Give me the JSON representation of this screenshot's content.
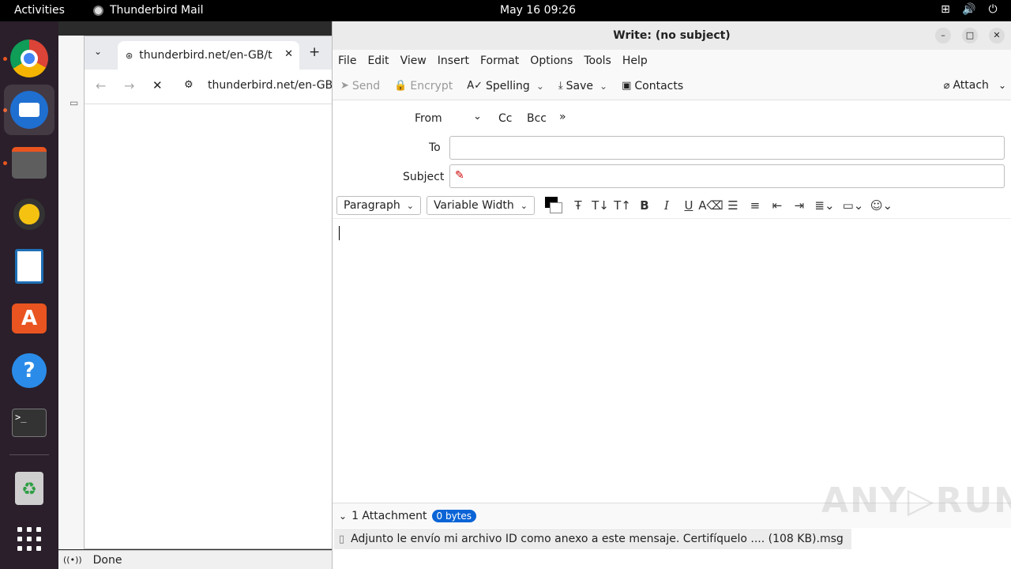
{
  "topbar": {
    "activities": "Activities",
    "app_name": "Thunderbird Mail",
    "clock": "May 16  09:26",
    "tray_icons": [
      "network-icon",
      "volume-icon",
      "power-icon"
    ]
  },
  "dock": {
    "items": [
      "chrome",
      "thunderbird",
      "files",
      "rhythmbox",
      "writer",
      "app-center",
      "help",
      "terminal",
      "trash",
      "app-grid"
    ]
  },
  "browser": {
    "tab_title": "thunderbird.net/en-GB/t",
    "new_tab": "+",
    "url": "thunderbird.net/en-GB/t",
    "status": "Done"
  },
  "compose": {
    "title": "Write: (no subject)",
    "menu": [
      "File",
      "Edit",
      "View",
      "Insert",
      "Format",
      "Options",
      "Tools",
      "Help"
    ],
    "toolbar": {
      "send": "Send",
      "encrypt": "Encrypt",
      "spelling": "Spelling",
      "save": "Save",
      "contacts": "Contacts",
      "attach": "Attach"
    },
    "header": {
      "from_label": "From",
      "cc": "Cc",
      "bcc": "Bcc",
      "to_label": "To",
      "to_value": "",
      "subject_label": "Subject",
      "subject_value": ""
    },
    "format": {
      "paragraph": "Paragraph",
      "font": "Variable Width",
      "text_color": "#000000"
    },
    "attachments": {
      "summary": "1 Attachment",
      "size_badge": "0 bytes",
      "file": "Adjunto le envío mi archivo ID como anexo a este mensaje. Certifíquelo .... (108 KB).msg"
    }
  }
}
